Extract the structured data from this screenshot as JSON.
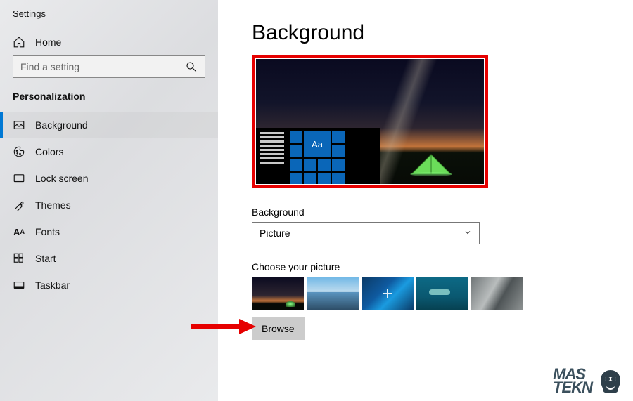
{
  "app_title": "Settings",
  "sidebar": {
    "home_label": "Home",
    "search_placeholder": "Find a setting",
    "section_label": "Personalization",
    "items": [
      {
        "label": "Background"
      },
      {
        "label": "Colors"
      },
      {
        "label": "Lock screen"
      },
      {
        "label": "Themes"
      },
      {
        "label": "Fonts"
      },
      {
        "label": "Start"
      },
      {
        "label": "Taskbar"
      }
    ]
  },
  "main": {
    "page_title": "Background",
    "preview_sample_text": "Aa",
    "dropdown": {
      "label": "Background",
      "value": "Picture"
    },
    "choose_label": "Choose your picture",
    "browse_label": "Browse"
  },
  "watermark": {
    "line1": "MAS",
    "line2": "TEKN"
  }
}
